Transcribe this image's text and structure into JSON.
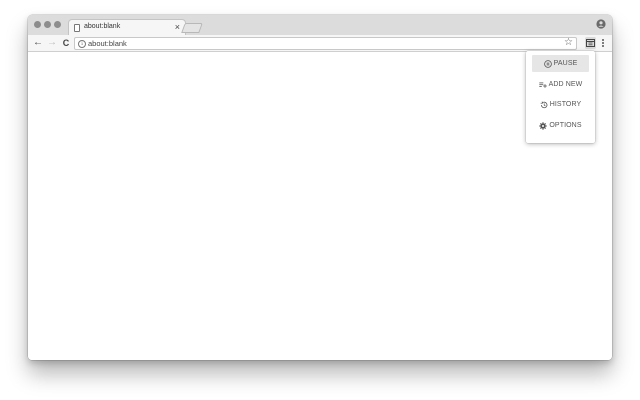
{
  "tab": {
    "title": "about:blank",
    "close": "×"
  },
  "nav": {
    "back": "←",
    "forward": "→",
    "reload": "C"
  },
  "omnibox": {
    "url": "about:blank",
    "info": "i",
    "star": "☆"
  },
  "popup": {
    "items": [
      {
        "label": "PAUSE",
        "icon": "pause-circle-icon",
        "active": true
      },
      {
        "label": "ADD NEW",
        "icon": "playlist-add-icon",
        "active": false
      },
      {
        "label": "HISTORY",
        "icon": "history-icon",
        "active": false
      },
      {
        "label": "OPTIONS",
        "icon": "gear-icon",
        "active": false
      }
    ]
  },
  "colors": {
    "titlebar": "#dcdcdc",
    "toolbar": "#f6f6f6",
    "popup_active": "#e6e6e6"
  }
}
